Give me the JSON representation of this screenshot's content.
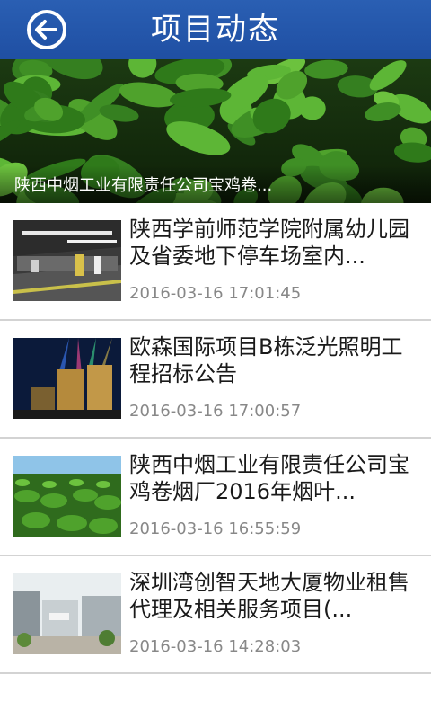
{
  "header": {
    "title": "项目动态",
    "back_icon": "back-arrow-icon",
    "bg_color": "#2456aa"
  },
  "banner": {
    "caption": "陕西中烟工业有限责任公司宝鸡卷..."
  },
  "items": [
    {
      "title": "陕西学前师范学院附属幼儿园及省委地下停车场室内...",
      "time": "2016-03-16 17:01:45"
    },
    {
      "title": "欧森国际项目B栋泛光照明工程招标公告",
      "time": "2016-03-16 17:00:57"
    },
    {
      "title": "陕西中烟工业有限责任公司宝鸡卷烟厂2016年烟叶...",
      "time": "2016-03-16 16:55:59"
    },
    {
      "title": "深圳湾创智天地大厦物业租售代理及相关服务项目(...",
      "time": "2016-03-16 14:28:03"
    }
  ]
}
